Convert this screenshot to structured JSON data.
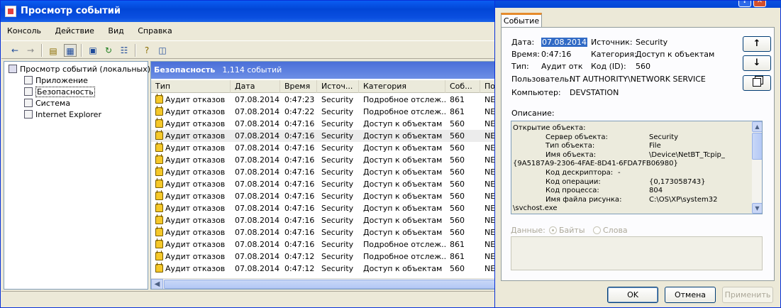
{
  "main_window": {
    "title": "Просмотр событий",
    "menu": [
      "Консоль",
      "Действие",
      "Вид",
      "Справка"
    ]
  },
  "tree": {
    "root": "Просмотр событий (локальных)",
    "items": [
      "Приложение",
      "Безопасность",
      "Система",
      "Internet Explorer"
    ]
  },
  "list": {
    "title": "Безопасность",
    "count": "1,114 событий",
    "columns": [
      "Тип",
      "Дата",
      "Время",
      "Источ...",
      "Категория",
      "Соб...",
      "По"
    ],
    "rows": [
      [
        "Аудит отказов",
        "07.08.2014",
        "0:47:23",
        "Security",
        "Подробное отслеж...",
        "861",
        "NE"
      ],
      [
        "Аудит отказов",
        "07.08.2014",
        "0:47:22",
        "Security",
        "Подробное отслеж...",
        "861",
        "NE"
      ],
      [
        "Аудит отказов",
        "07.08.2014",
        "0:47:16",
        "Security",
        "Доступ к объектам",
        "560",
        "NE"
      ],
      [
        "Аудит отказов",
        "07.08.2014",
        "0:47:16",
        "Security",
        "Доступ к объектам",
        "560",
        "NE"
      ],
      [
        "Аудит отказов",
        "07.08.2014",
        "0:47:16",
        "Security",
        "Доступ к объектам",
        "560",
        "NE"
      ],
      [
        "Аудит отказов",
        "07.08.2014",
        "0:47:16",
        "Security",
        "Доступ к объектам",
        "560",
        "NE"
      ],
      [
        "Аудит отказов",
        "07.08.2014",
        "0:47:16",
        "Security",
        "Доступ к объектам",
        "560",
        "NE"
      ],
      [
        "Аудит отказов",
        "07.08.2014",
        "0:47:16",
        "Security",
        "Доступ к объектам",
        "560",
        "NE"
      ],
      [
        "Аудит отказов",
        "07.08.2014",
        "0:47:16",
        "Security",
        "Доступ к объектам",
        "560",
        "NE"
      ],
      [
        "Аудит отказов",
        "07.08.2014",
        "0:47:16",
        "Security",
        "Доступ к объектам",
        "560",
        "NE"
      ],
      [
        "Аудит отказов",
        "07.08.2014",
        "0:47:16",
        "Security",
        "Доступ к объектам",
        "560",
        "NE"
      ],
      [
        "Аудит отказов",
        "07.08.2014",
        "0:47:16",
        "Security",
        "Доступ к объектам",
        "560",
        "NE"
      ],
      [
        "Аудит отказов",
        "07.08.2014",
        "0:47:16",
        "Security",
        "Подробное отслеж...",
        "861",
        "NE"
      ],
      [
        "Аудит отказов",
        "07.08.2014",
        "0:47:12",
        "Security",
        "Подробное отслеж...",
        "861",
        "NE"
      ],
      [
        "Аудит отказов",
        "07.08.2014",
        "0:47:12",
        "Security",
        "Доступ к объектам",
        "560",
        "NE"
      ]
    ]
  },
  "dialog": {
    "tab": "Событие",
    "fields": {
      "date_label": "Дата:",
      "date_value": "07.08.2014",
      "source_label": "Источник:",
      "source_value": "Security",
      "time_label": "Время:",
      "time_value": "0:47:16",
      "category_label": "Категория:",
      "category_value": "Доступ к объектам",
      "type_label": "Тип:",
      "type_value": "Аудит отк",
      "code_label": "Код (ID):",
      "code_value": "560",
      "user_label": "Пользователь:",
      "user_value": "NT AUTHORITY\\NETWORK SERVICE",
      "computer_label": "Компьютер:",
      "computer_value": "DEVSTATION"
    },
    "description_label": "Описание:",
    "description_lines": [
      {
        "text": "Открытие объекта:",
        "indent": 0
      },
      {
        "text": "Сервер объекта:",
        "indent": 1,
        "value": "Security"
      },
      {
        "text": "Тип объекта:",
        "indent": 1,
        "value": "File"
      },
      {
        "text": "Имя объекта:",
        "indent": 1,
        "value": "\\Device\\NetBT_Tcpip_"
      },
      {
        "text": "{9A5187A9-2306-4FAE-8D41-6FDA7FB06980}",
        "indent": 0
      },
      {
        "text": "Код дескриптора:",
        "indent": 1,
        "value": "-"
      },
      {
        "text": "Код операции:",
        "indent": 1,
        "value": "{0,173058743}"
      },
      {
        "text": "Код процесса:",
        "indent": 1,
        "value": "804"
      },
      {
        "text": "Имя файла рисунка:",
        "indent": 1,
        "value": "C:\\OS\\XP\\system32"
      },
      {
        "text": "\\svchost.exe",
        "indent": 0
      }
    ],
    "data_label": "Данные:",
    "radio_bytes": "Байты",
    "radio_words": "Слова",
    "buttons": {
      "ok": "OK",
      "cancel": "Отмена",
      "apply": "Применить"
    },
    "side_icons": {
      "up": "↑",
      "down": "↓",
      "copy": "copy-icon"
    }
  }
}
